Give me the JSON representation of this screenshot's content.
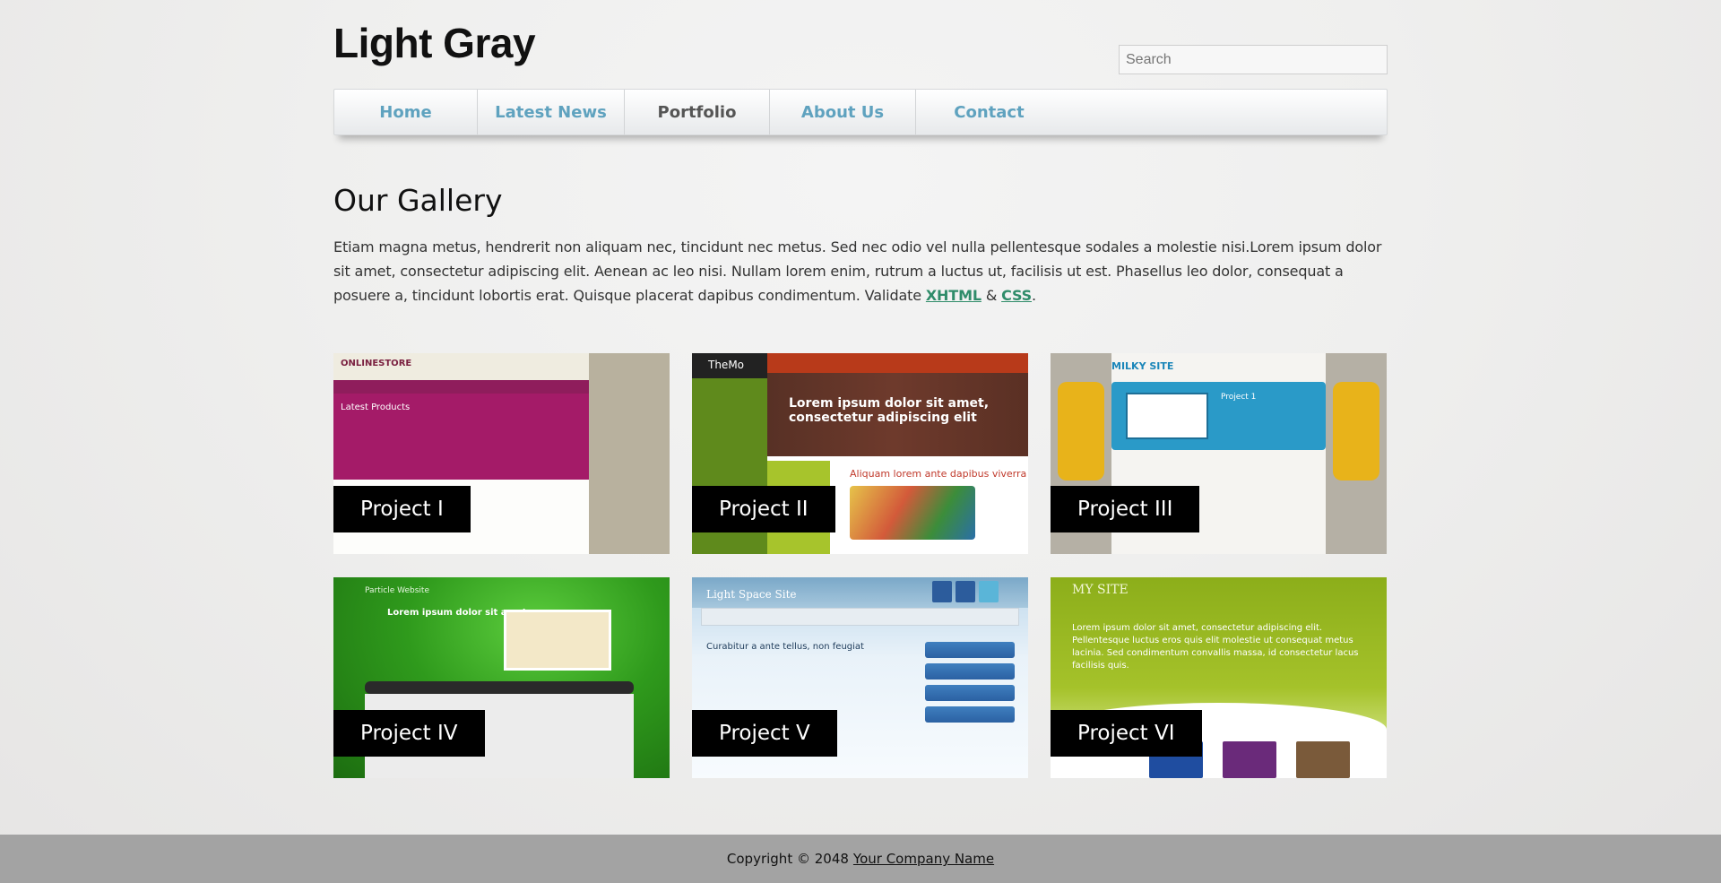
{
  "header": {
    "logo": "Light Gray",
    "search_placeholder": "Search"
  },
  "nav": {
    "items": [
      {
        "label": "Home",
        "active": false
      },
      {
        "label": "Latest News",
        "active": false
      },
      {
        "label": "Portfolio",
        "active": true
      },
      {
        "label": "About Us",
        "active": false
      },
      {
        "label": "Contact",
        "active": false
      }
    ]
  },
  "main": {
    "title": "Our Gallery",
    "intro_text": "Etiam magna metus, hendrerit non aliquam nec, tincidunt nec metus. Sed nec odio vel nulla pellentesque sodales a molestie nisi.Lorem ipsum dolor sit amet, consectetur adipiscing elit. Aenean ac leo nisi. Nullam lorem enim, rutrum a luctus ut, facilisis ut est. Phasellus leo dolor, consequat a posuere a, tincidunt lobortis erat. Quisque placerat dapibus condimentum. Validate ",
    "link_xhtml": "XHTML",
    "amp": " & ",
    "link_css": "CSS",
    "period": "."
  },
  "gallery": {
    "projects": [
      {
        "caption": "Project I",
        "thumb": {
          "brand": "ONLINESTORE",
          "section": "Latest Products"
        }
      },
      {
        "caption": "Project II",
        "thumb": {
          "brand": "TheMo",
          "headline": "Lorem ipsum dolor sit amet, consectetur adipiscing elit",
          "subhead": "Aliquam lorem ante dapibus viverra"
        }
      },
      {
        "caption": "Project III",
        "thumb": {
          "brand": "MILKY SITE",
          "panel": "Project 1"
        }
      },
      {
        "caption": "Project IV",
        "thumb": {
          "brand": "Particle Website",
          "headline": "Lorem ipsum dolor sit amet"
        }
      },
      {
        "caption": "Project V",
        "thumb": {
          "brand": "Light Space Site",
          "headline": "Curabitur a ante tellus, non feugiat"
        }
      },
      {
        "caption": "Project VI",
        "thumb": {
          "brand": "MY SITE",
          "text": "Lorem ipsum dolor sit amet, consectetur adipiscing elit. Pellentesque luctus eros quis elit molestie ut consequat metus lacinia. Sed condimentum convallis massa, id consectetur lacus facilisis quis."
        }
      }
    ]
  },
  "footer": {
    "copyright": "Copyright © 2048",
    "company_link": "Your Company Name"
  },
  "colors": {
    "nav_link": "#5fa2bf",
    "nav_active": "#555555",
    "inline_link": "#2f8c6a",
    "footer_bg": "#a3a3a3",
    "caption_bg": "#000000"
  }
}
